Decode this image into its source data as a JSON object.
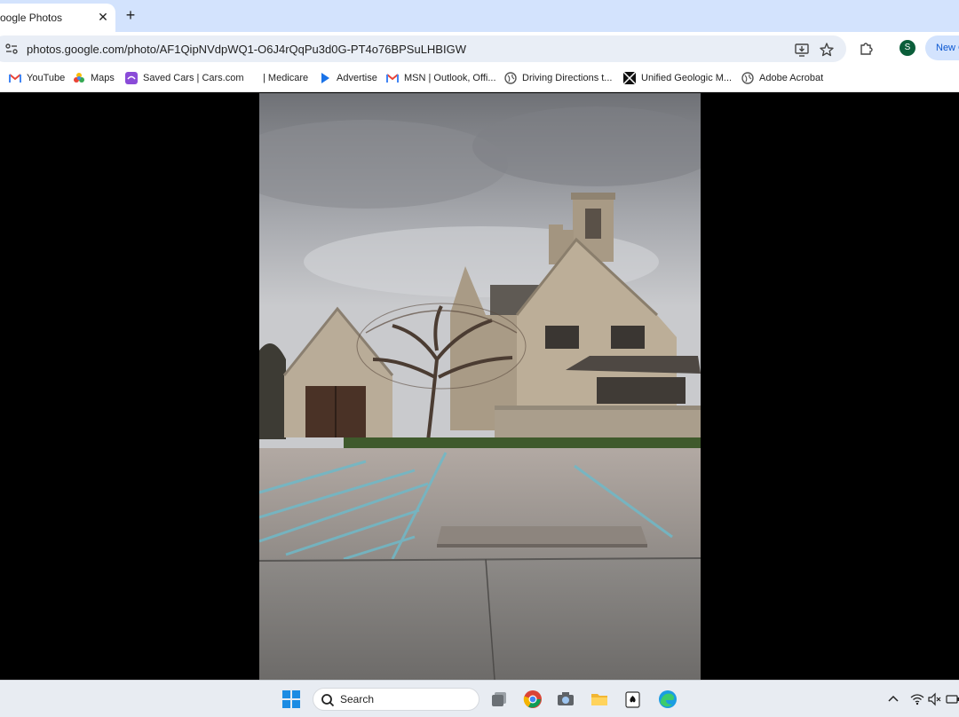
{
  "browser": {
    "tab": {
      "title": "oogle Photos",
      "close_glyph": "✕"
    },
    "new_tab_glyph": "+",
    "url": "photos.google.com/photo/AF1QipNVdpWQ1-O6J4rQqPu3d0G-PT4o76BPSuLHBIGW",
    "profile_initial": "S",
    "new_chrome_label": "New C",
    "accent_color": "#d3e3fd"
  },
  "bookmarks": [
    {
      "label": "YouTube",
      "icon": "gmail-icon"
    },
    {
      "label": "Maps",
      "icon": "maps-icon"
    },
    {
      "label": "Saved Cars | Cars.com",
      "icon": "cars-icon"
    },
    {
      "label": "| Medicare",
      "icon": ""
    },
    {
      "label": "Advertise",
      "icon": "play-icon"
    },
    {
      "label": "MSN | Outlook, Offi...",
      "icon": "gmail-icon"
    },
    {
      "label": "Driving Directions t...",
      "icon": "globe-icon"
    },
    {
      "label": "Unified Geologic M...",
      "icon": "geologic-icon"
    },
    {
      "label": "Adobe Acrobat",
      "icon": "globe-icon"
    }
  ],
  "taskbar": {
    "search_label": "Search",
    "apps": [
      "windows-start-icon",
      "task-view-icon",
      "chrome-icon",
      "camera-icon",
      "file-explorer-icon",
      "solitaire-icon",
      "edge-icon"
    ],
    "tray": [
      "chevron-up-icon",
      "wifi-icon",
      "speaker-muted-icon",
      "battery-icon"
    ]
  }
}
